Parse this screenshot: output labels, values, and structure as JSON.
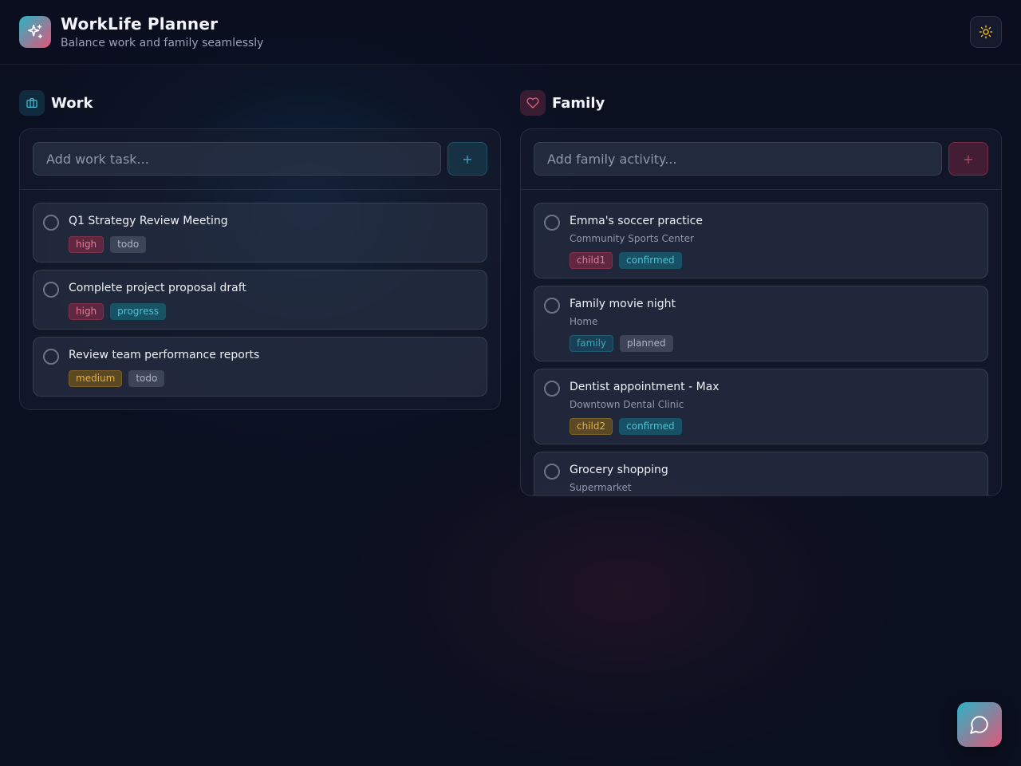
{
  "app": {
    "title": "WorkLife Planner",
    "subtitle": "Balance work and family seamlessly",
    "logo_icon": "sparkles-icon",
    "theme_icon": "sun-icon",
    "accent_gradient": [
      "#2bb3c6",
      "#e05577"
    ]
  },
  "work": {
    "heading": "Work",
    "icon": "briefcase-icon",
    "input_placeholder": "Add work task...",
    "add_label": "+",
    "tasks": [
      {
        "title": "Q1 Strategy Review Meeting",
        "priority": "high",
        "status": "todo"
      },
      {
        "title": "Complete project proposal draft",
        "priority": "high",
        "status": "progress"
      },
      {
        "title": "Review team performance reports",
        "priority": "medium",
        "status": "todo"
      }
    ]
  },
  "family": {
    "heading": "Family",
    "icon": "heart-icon",
    "input_placeholder": "Add family activity...",
    "add_label": "+",
    "activities": [
      {
        "title": "Emma's soccer practice",
        "location": "Community Sports Center",
        "member": "child1",
        "status": "confirmed"
      },
      {
        "title": "Family movie night",
        "location": "Home",
        "member": "family",
        "status": "planned"
      },
      {
        "title": "Dentist appointment - Max",
        "location": "Downtown Dental Clinic",
        "member": "child2",
        "status": "confirmed"
      },
      {
        "title": "Grocery shopping",
        "location": "Supermarket"
      }
    ]
  },
  "chat": {
    "icon": "chat-bubble-icon"
  }
}
